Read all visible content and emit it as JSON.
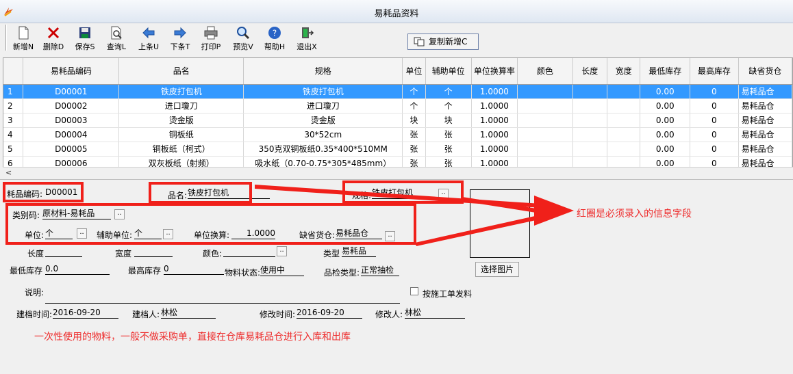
{
  "window": {
    "title": "易耗品资料"
  },
  "toolbar": {
    "buttons": [
      {
        "label": "新增N",
        "icon": "new-icon"
      },
      {
        "label": "删除D",
        "icon": "delete-icon"
      },
      {
        "label": "保存S",
        "icon": "save-icon"
      },
      {
        "label": "查询L",
        "icon": "query-icon"
      },
      {
        "label": "上条U",
        "icon": "prev-icon"
      },
      {
        "label": "下条T",
        "icon": "next-icon"
      },
      {
        "label": "打印P",
        "icon": "print-icon"
      },
      {
        "label": "预览V",
        "icon": "preview-icon"
      },
      {
        "label": "帮助H",
        "icon": "help-icon"
      },
      {
        "label": "退出X",
        "icon": "exit-icon"
      }
    ],
    "copy_new_label": "复制新增C"
  },
  "grid": {
    "columns": [
      "",
      "易耗品编码",
      "品名",
      "规格",
      "单位",
      "辅助单位",
      "单位换算率",
      "颜色",
      "长度",
      "宽度",
      "最低库存",
      "最高库存",
      "缺省货仓"
    ],
    "rows": [
      [
        "1",
        "D00001",
        "铁皮打包机",
        "铁皮打包机",
        "个",
        "个",
        "1.0000",
        "",
        "",
        "",
        "0.00",
        "0",
        "易耗品仓"
      ],
      [
        "2",
        "D00002",
        "进口瓊刀",
        "进口瓊刀",
        "个",
        "个",
        "1.0000",
        "",
        "",
        "",
        "0.00",
        "0",
        "易耗品仓"
      ],
      [
        "3",
        "D00003",
        "烫金版",
        "烫金版",
        "块",
        "块",
        "1.0000",
        "",
        "",
        "",
        "0.00",
        "0",
        "易耗品仓"
      ],
      [
        "4",
        "D00004",
        "铜板纸",
        "30*52cm",
        "张",
        "张",
        "1.0000",
        "",
        "",
        "",
        "0.00",
        "0",
        "易耗品仓"
      ],
      [
        "5",
        "D00005",
        "铜板纸（柯式）",
        "350克双铜板纸0.35*400*510MM",
        "张",
        "张",
        "1.0000",
        "",
        "",
        "",
        "0.00",
        "0",
        "易耗品仓"
      ],
      [
        "6",
        "D00006",
        "双灰板纸（射频）",
        "吸水纸（0.70-0.75*305*485mm）",
        "张",
        "张",
        "1.0000",
        "",
        "",
        "",
        "0.00",
        "0",
        "易耗品仓"
      ]
    ],
    "selected_row": 0
  },
  "form": {
    "code_label": "耗品编码:",
    "code_value": "D00001",
    "name_label": "品名:",
    "name_value": "铁皮打包机",
    "spec_label": "规格:",
    "spec_value": "铁皮打包机",
    "category_label": "类别码:",
    "category_value": "原材料-易耗品",
    "unit_label": "单位:",
    "unit_value": "个",
    "aux_unit_label": "辅助单位:",
    "aux_unit_value": "个",
    "conversion_label": "单位换算:",
    "conversion_value": "1.0000",
    "default_warehouse_label": "缺省货仓:",
    "default_warehouse_value": "易耗品仓",
    "length_label": "长度",
    "width_label": "宽度",
    "color_label": "颜色:",
    "type_label": "类型",
    "type_value": "易耗品",
    "min_stock_label": "最低库存",
    "min_stock_value": "0.0",
    "max_stock_label": "最高库存",
    "max_stock_value": "0",
    "material_status_label": "物料状态:",
    "material_status_value": "使用中",
    "qc_type_label": "品检类型:",
    "qc_type_value": "正常抽检",
    "note_label": "说明:",
    "issue_by_order_label": "按施工单发料",
    "created_time_label": "建档时间:",
    "created_time_value": "2016-09-20",
    "creator_label": "建档人:",
    "creator_value": "林松",
    "modified_time_label": "修改时间:",
    "modified_time_value": "2016-09-20",
    "modifier_label": "修改人:",
    "modifier_value": "林松",
    "select_image_label": "选择图片"
  },
  "annotations": {
    "required_note": "红圈是必须录入的信息字段",
    "usage_note": "一次性使用的物料，一般不做采购单，直接在仓库易耗品仓进行入库和出库",
    "color": "#ee2b2b"
  }
}
